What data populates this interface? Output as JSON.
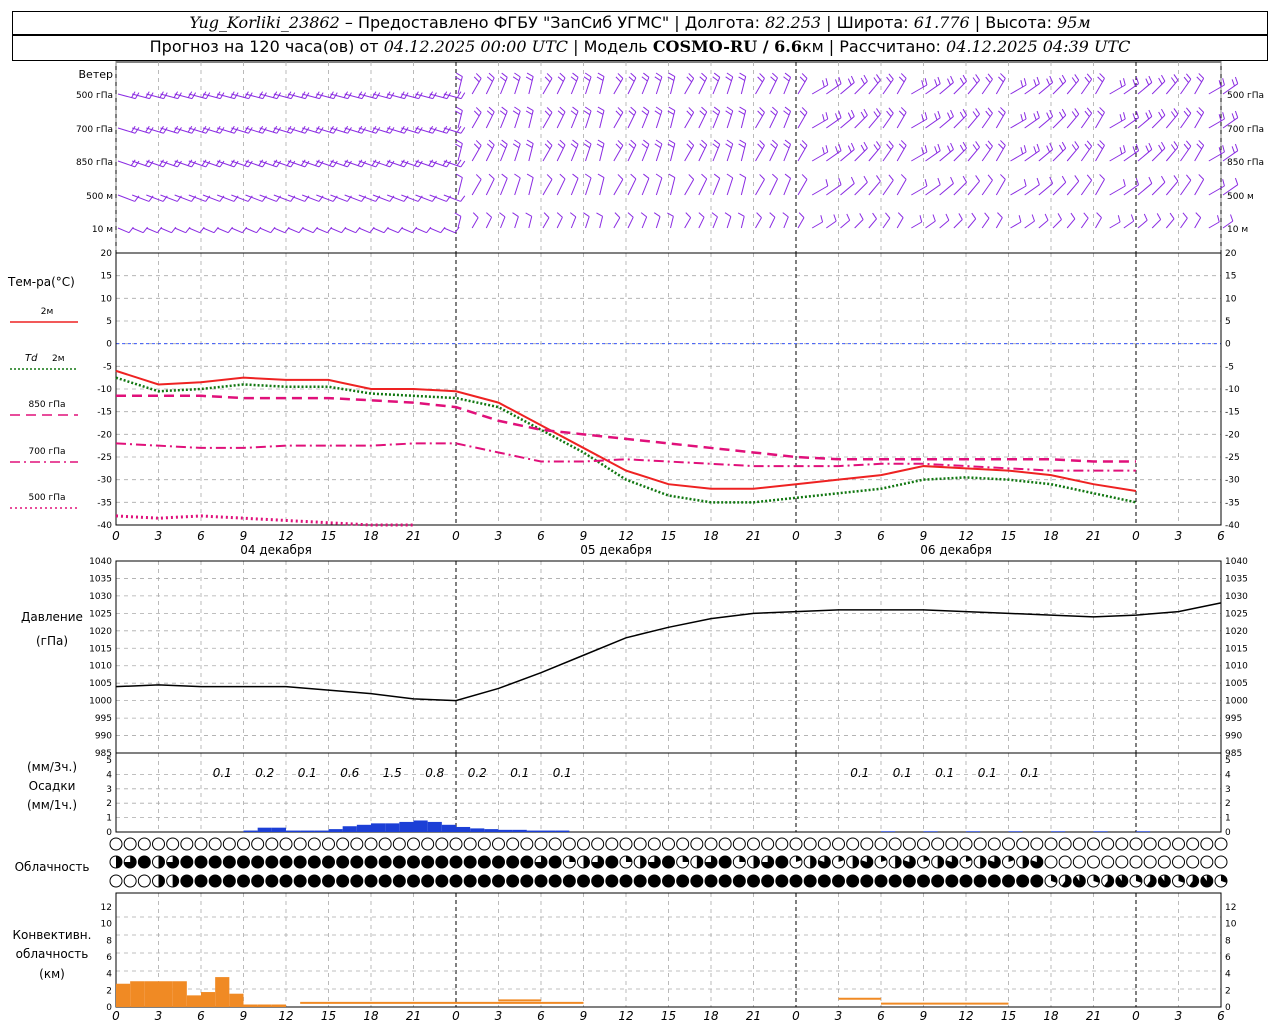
{
  "header": {
    "station": "Yug_Korliki_23862",
    "provider": "– Предоставлено ФГБУ \"ЗапСиб УГМС\"",
    "lon_label": "Долгота:",
    "lon": "82.253",
    "lat_label": "Широта:",
    "lat": "61.776",
    "alt_label": "Высота:",
    "alt": "95м",
    "forecast_label": "Прогноз на 120 часа(ов) от",
    "forecast_from": "04.12.2025 00:00 UTC",
    "model_label": "Модель",
    "model": "COSMO-RU / 6.6",
    "model_unit": "км",
    "calc_label": "Рассчитано:",
    "calc_time": "04.12.2025 04:39 UTC"
  },
  "x_axis": {
    "hour_ticks": [
      "0",
      "3",
      "6",
      "9",
      "12",
      "15",
      "18",
      "21",
      "0",
      "3",
      "6",
      "9",
      "12",
      "15",
      "18",
      "21",
      "0",
      "3",
      "6",
      "9",
      "12",
      "15",
      "18",
      "21",
      "0",
      "3",
      "6"
    ],
    "day_labels": [
      "04 декабря",
      "05 декабря",
      "06 декабря"
    ]
  },
  "panels": {
    "wind": {
      "title": "Ветер",
      "levels": [
        "500 гПа",
        "700 гПа",
        "850 гПа",
        "500 м",
        "10 м"
      ],
      "color": "#8a2be2"
    },
    "temperature": {
      "title": "Тем-ра(°C)",
      "y_ticks": [
        "20",
        "15",
        "10",
        "5",
        "0",
        "-5",
        "-10",
        "-15",
        "-20",
        "-25",
        "-30",
        "-35",
        "-40"
      ],
      "legend": [
        {
          "label": "2м",
          "color": "#ee2222",
          "style": "solid"
        },
        {
          "label_prefix": "Td",
          "label": "2м",
          "color": "#117711",
          "style": "dotted"
        },
        {
          "label": "850 гПа",
          "color": "#e0107a",
          "style": "dashed"
        },
        {
          "label": "700 гПа",
          "color": "#e0107a",
          "style": "dashdot"
        },
        {
          "label": "500 гПа",
          "color": "#e0107a",
          "style": "dots"
        }
      ]
    },
    "pressure": {
      "title": "Давление",
      "unit": "(гПа)",
      "y_ticks": [
        "1040",
        "1035",
        "1030",
        "1025",
        "1020",
        "1015",
        "1010",
        "1005",
        "1000",
        "995",
        "990",
        "985"
      ]
    },
    "precip": {
      "unit_top": "(мм/3ч.)",
      "title": "Осадки",
      "unit_bottom": "(мм/1ч.)",
      "y_ticks": [
        "5",
        "4",
        "3",
        "2",
        "1",
        "0"
      ],
      "labels_3h": [
        "0.1",
        "0.2",
        "0.1",
        "0.6",
        "1.5",
        "0.8",
        "0.2",
        "0.1",
        "0.1",
        "0.1",
        "0.1",
        "0.1",
        "0.1",
        "0.1"
      ],
      "color": "#1c3fd6"
    },
    "clouds": {
      "title": "Облачность"
    },
    "convective": {
      "title_1": "Конвективн.",
      "title_2": "облачность",
      "unit": "(км)",
      "y_ticks": [
        "12",
        "10",
        "8",
        "6",
        "4",
        "2",
        "0"
      ],
      "color": "#f08a24"
    }
  },
  "chart_data": [
    {
      "type": "line",
      "title": "Тем-ра(°C)",
      "x_unit": "hours from 04.12.2025 00:00 UTC",
      "ylim": [
        -40,
        20
      ],
      "series": [
        {
          "name": "2м",
          "x": [
            0,
            3,
            6,
            9,
            12,
            15,
            18,
            21,
            24,
            27,
            30,
            33,
            36,
            39,
            42,
            45,
            48,
            51,
            54,
            57,
            60,
            63,
            66,
            69,
            72
          ],
          "values": [
            -6,
            -9,
            -8.5,
            -7.5,
            -8,
            -8,
            -10,
            -10,
            -10.5,
            -13,
            -18,
            -23,
            -28,
            -31,
            -32,
            -32,
            -31,
            -30,
            -29,
            -27,
            -27.5,
            -28,
            -29,
            -31,
            -32.5
          ]
        },
        {
          "name": "Td 2м",
          "x": [
            0,
            3,
            6,
            9,
            12,
            15,
            18,
            21,
            24,
            27,
            30,
            33,
            36,
            39,
            42,
            45,
            48,
            51,
            54,
            57,
            60,
            63,
            66,
            69,
            72
          ],
          "values": [
            -7.5,
            -10.5,
            -10,
            -9,
            -9.5,
            -9.5,
            -11,
            -11.5,
            -12,
            -14,
            -19,
            -24,
            -30,
            -33.5,
            -35,
            -35,
            -34,
            -33,
            -32,
            -30,
            -29.5,
            -30,
            -31,
            -33,
            -35
          ]
        },
        {
          "name": "850 гПа",
          "x": [
            0,
            3,
            6,
            9,
            12,
            15,
            18,
            21,
            24,
            27,
            30,
            33,
            36,
            39,
            42,
            45,
            48,
            51,
            54,
            57,
            60,
            63,
            66,
            69,
            72
          ],
          "values": [
            -11.5,
            -11.5,
            -11.5,
            -12,
            -12,
            -12,
            -12.5,
            -13,
            -14,
            -17,
            -19,
            -20,
            -21,
            -22,
            -23,
            -24,
            -25,
            -25.5,
            -25.5,
            -25.5,
            -25.5,
            -25.5,
            -25.5,
            -26,
            -26
          ]
        },
        {
          "name": "700 гПа",
          "x": [
            0,
            3,
            6,
            9,
            12,
            15,
            18,
            21,
            24,
            27,
            30,
            33,
            36,
            39,
            42,
            45,
            48,
            51,
            54,
            57,
            60,
            63,
            66,
            69,
            72
          ],
          "values": [
            -22,
            -22.5,
            -23,
            -23,
            -22.5,
            -22.5,
            -22.5,
            -22,
            -22,
            -24,
            -26,
            -26,
            -25.5,
            -26,
            -26.5,
            -27,
            -27,
            -27,
            -26.5,
            -26.5,
            -27,
            -27.5,
            -28,
            -28,
            -28
          ]
        },
        {
          "name": "500 гПа",
          "x": [
            0,
            3,
            6,
            9,
            12,
            15,
            18,
            21
          ],
          "values": [
            -38,
            -38.5,
            -38,
            -38.5,
            -39,
            -39.5,
            -40,
            -40
          ]
        }
      ]
    },
    {
      "type": "line",
      "title": "Давление",
      "x_unit": "hours from 04.12.2025 00:00 UTC",
      "ylim": [
        985,
        1040
      ],
      "series": [
        {
          "name": "Давление",
          "x": [
            0,
            3,
            6,
            9,
            12,
            15,
            18,
            21,
            24,
            27,
            30,
            33,
            36,
            39,
            42,
            45,
            48,
            51,
            54,
            57,
            60,
            63,
            66,
            69,
            72,
            75,
            78
          ],
          "values": [
            1004,
            1004.5,
            1004,
            1004,
            1004,
            1003,
            1002,
            1000.5,
            1000,
            1003.5,
            1008,
            1013,
            1018,
            1021,
            1023.5,
            1025,
            1025.5,
            1026,
            1026,
            1026,
            1025.5,
            1025,
            1024.5,
            1024,
            1024.5,
            1025.5,
            1028
          ]
        }
      ]
    },
    {
      "type": "bar",
      "title": "Осадки",
      "x_unit": "hours from 04.12.2025 00:00 UTC",
      "ylim": [
        0,
        5
      ],
      "x": [
        9,
        10,
        11,
        12,
        13,
        14,
        15,
        16,
        17,
        18,
        19,
        20,
        21,
        22,
        23,
        24,
        25,
        26,
        27,
        28,
        29,
        30,
        31,
        54,
        57,
        60,
        63,
        66,
        69,
        72
      ],
      "values": [
        0.1,
        0.3,
        0.3,
        0.1,
        0.1,
        0.1,
        0.2,
        0.4,
        0.5,
        0.6,
        0.6,
        0.7,
        0.8,
        0.7,
        0.5,
        0.35,
        0.25,
        0.2,
        0.15,
        0.15,
        0.1,
        0.1,
        0.1,
        0.05,
        0.05,
        0.05,
        0.05,
        0.05,
        0.05,
        0.05
      ]
    },
    {
      "type": "bar",
      "title": "Конвективн. облачность",
      "x_unit": "hours from 04.12.2025 00:00 UTC",
      "ylim": [
        0,
        13
      ],
      "x": [
        0,
        1,
        2,
        3,
        4,
        5,
        6,
        7,
        8,
        9,
        10,
        11
      ],
      "values": [
        2.8,
        3.1,
        3.1,
        3.1,
        3.1,
        1.4,
        1.8,
        3.6,
        1.6,
        0.3,
        0.3,
        0.3
      ]
    }
  ]
}
